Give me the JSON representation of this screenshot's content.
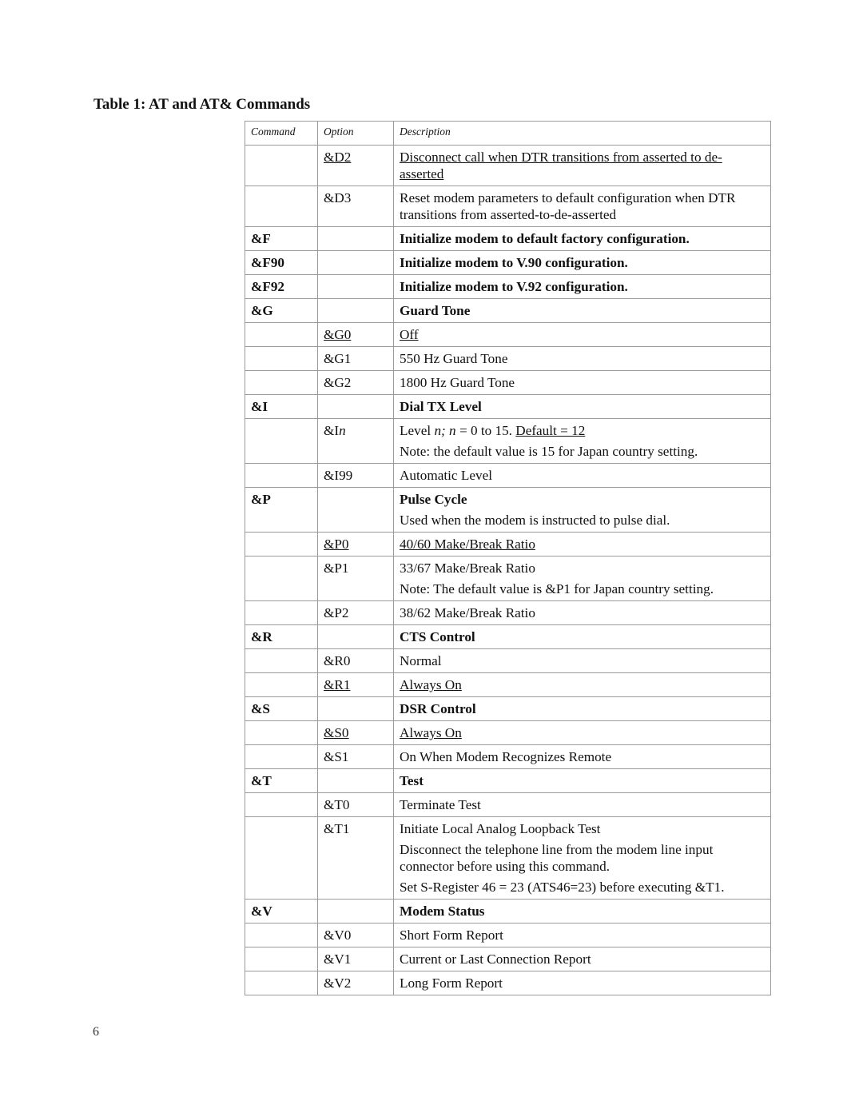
{
  "title": "Table 1: AT and AT& Commands",
  "headers": {
    "command": "Command",
    "option": "Option",
    "description": "Description"
  },
  "rows": [
    {
      "command": "",
      "option": "&D2",
      "option_underline": true,
      "description": "Disconnect call when DTR transitions from asserted to de-asserted ",
      "desc_underline": true,
      "bold": false
    },
    {
      "command": "",
      "option": "&D3",
      "description": "Reset modem parameters to default configuration when DTR transitions from asserted-to-de-asserted",
      "bold": false
    },
    {
      "command": "&F",
      "option": "",
      "description": "Initialize modem to default factory configuration.",
      "bold": true
    },
    {
      "command": "&F90",
      "option": "",
      "description": "Initialize modem to V.90 configuration.",
      "bold": true
    },
    {
      "command": "&F92",
      "option": "",
      "description": "Initialize modem to V.92 configuration.",
      "bold": true
    },
    {
      "command": "&G",
      "option": "",
      "description": "Guard Tone",
      "bold": true
    },
    {
      "command": "",
      "option": "&G0",
      "option_underline": true,
      "description": "Off",
      "desc_underline": true,
      "bold": false
    },
    {
      "command": "",
      "option": "&G1",
      "description": "550 Hz Guard Tone",
      "bold": false
    },
    {
      "command": "",
      "option": "&G2",
      "description": "1800 Hz Guard Tone",
      "bold": false
    },
    {
      "command": "&I",
      "option": "",
      "description": "Dial TX Level",
      "bold": true
    },
    {
      "command": "",
      "option_prefix": "&I",
      "option_italic": "n",
      "description_parts": {
        "a": "Level ",
        "b": "n; n",
        "c": " = 0 to 15. ",
        "d": "Default = 12"
      },
      "note": "Note: the default value is 15 for Japan country setting.",
      "bold": false
    },
    {
      "command": "",
      "option": "&I99",
      "description": "Automatic Level",
      "bold": false
    },
    {
      "command": "&P",
      "option": "",
      "description": "Pulse Cycle",
      "note": "Used when the modem is instructed to pulse dial.",
      "bold": true
    },
    {
      "command": "",
      "option": "&P0",
      "option_underline": true,
      "description": "40/60 Make/Break Ratio ",
      "desc_underline": true,
      "bold": false
    },
    {
      "command": "",
      "option": "&P1",
      "description": "33/67 Make/Break Ratio",
      "note": "Note: The default value is &P1 for Japan country setting.",
      "bold": false
    },
    {
      "command": "",
      "option": "&P2",
      "description": "38/62 Make/Break Ratio",
      "bold": false
    },
    {
      "command": "&R",
      "option": "",
      "description": "CTS Control",
      "bold": true
    },
    {
      "command": "",
      "option": "&R0",
      "description": "Normal",
      "bold": false
    },
    {
      "command": "",
      "option": "&R1",
      "option_underline": true,
      "description": "Always On ",
      "desc_underline": true,
      "bold": false
    },
    {
      "command": "&S",
      "option": "",
      "description": "DSR Control",
      "bold": true
    },
    {
      "command": "",
      "option": "&S0",
      "option_underline": true,
      "description": "Always On ",
      "desc_underline": true,
      "bold": false
    },
    {
      "command": "",
      "option": "&S1",
      "description": "On When Modem Recognizes Remote",
      "bold": false
    },
    {
      "command": "&T",
      "option": "",
      "description": "Test",
      "bold": true
    },
    {
      "command": "",
      "option": "&T0",
      "description": "Terminate Test",
      "bold": false
    },
    {
      "command": "",
      "option": "&T1",
      "description": "Initiate Local Analog Loopback Test",
      "note": "Disconnect the telephone line from the modem line input connector before using this command.",
      "note2": "Set S-Register 46 = 23 (ATS46=23) before executing &T1.",
      "bold": false
    },
    {
      "command": "&V",
      "option": "",
      "description": "Modem Status",
      "bold": true
    },
    {
      "command": "",
      "option": "&V0",
      "description": "Short Form Report",
      "bold": false
    },
    {
      "command": "",
      "option": "&V1",
      "description": "Current or Last Connection Report",
      "bold": false
    },
    {
      "command": "",
      "option": "&V2",
      "description": "Long Form Report",
      "bold": false
    }
  ],
  "page_number": "6"
}
